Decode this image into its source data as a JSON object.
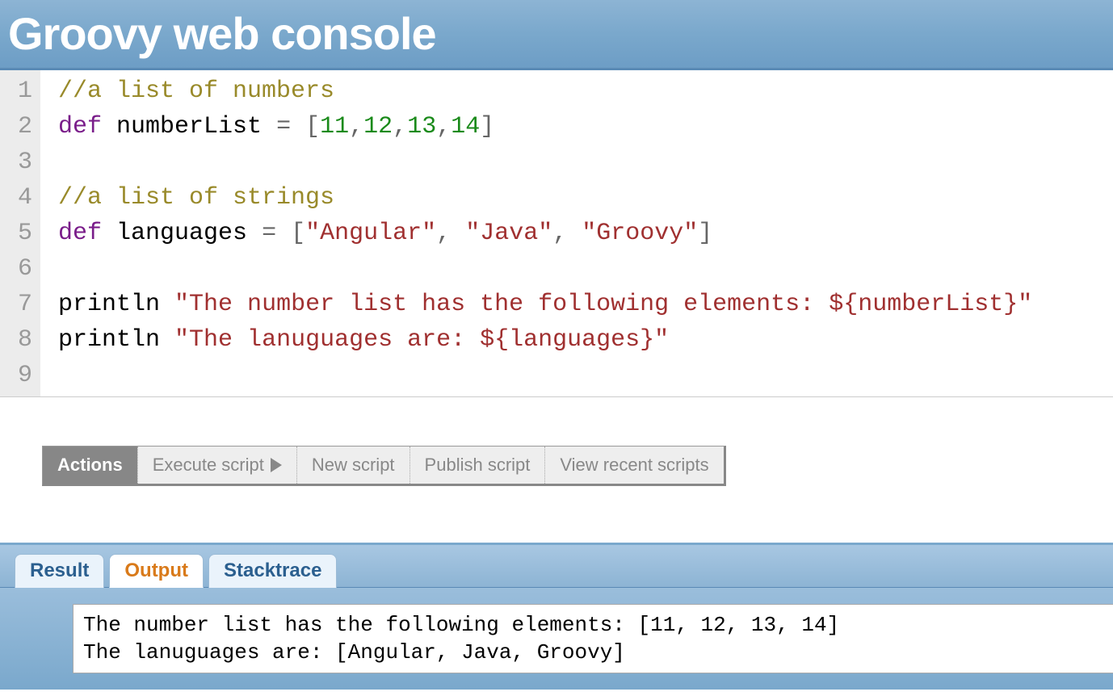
{
  "header": {
    "title": "Groovy web console"
  },
  "editor": {
    "line_numbers": [
      "1",
      "2",
      "3",
      "4",
      "5",
      "6",
      "7",
      "8",
      "9"
    ],
    "lines": [
      [
        {
          "t": "comment",
          "v": "//a list of numbers"
        }
      ],
      [
        {
          "t": "keyword",
          "v": "def"
        },
        {
          "t": "space",
          "v": " "
        },
        {
          "t": "ident",
          "v": "numberList"
        },
        {
          "t": "space",
          "v": " "
        },
        {
          "t": "punct",
          "v": "="
        },
        {
          "t": "space",
          "v": " "
        },
        {
          "t": "bracket",
          "v": "["
        },
        {
          "t": "number",
          "v": "11"
        },
        {
          "t": "punct",
          "v": ","
        },
        {
          "t": "number",
          "v": "12"
        },
        {
          "t": "punct",
          "v": ","
        },
        {
          "t": "number",
          "v": "13"
        },
        {
          "t": "punct",
          "v": ","
        },
        {
          "t": "number",
          "v": "14"
        },
        {
          "t": "bracket",
          "v": "]"
        }
      ],
      [],
      [
        {
          "t": "comment",
          "v": "//a list of strings"
        }
      ],
      [
        {
          "t": "keyword",
          "v": "def"
        },
        {
          "t": "space",
          "v": " "
        },
        {
          "t": "ident",
          "v": "languages"
        },
        {
          "t": "space",
          "v": " "
        },
        {
          "t": "punct",
          "v": "="
        },
        {
          "t": "space",
          "v": " "
        },
        {
          "t": "bracket",
          "v": "["
        },
        {
          "t": "string",
          "v": "\"Angular\""
        },
        {
          "t": "punct",
          "v": ","
        },
        {
          "t": "space",
          "v": " "
        },
        {
          "t": "string",
          "v": "\"Java\""
        },
        {
          "t": "punct",
          "v": ","
        },
        {
          "t": "space",
          "v": " "
        },
        {
          "t": "string",
          "v": "\"Groovy\""
        },
        {
          "t": "bracket",
          "v": "]"
        }
      ],
      [],
      [
        {
          "t": "ident",
          "v": "println"
        },
        {
          "t": "space",
          "v": " "
        },
        {
          "t": "string",
          "v": "\"The number list has the following elements: "
        },
        {
          "t": "interp",
          "v": "${numberList}"
        },
        {
          "t": "string",
          "v": "\""
        }
      ],
      [
        {
          "t": "ident",
          "v": "println"
        },
        {
          "t": "space",
          "v": " "
        },
        {
          "t": "string",
          "v": "\"The lanuguages are: "
        },
        {
          "t": "interp",
          "v": "${languages}"
        },
        {
          "t": "string",
          "v": "\""
        }
      ],
      []
    ]
  },
  "toolbar": {
    "label": "Actions",
    "buttons": {
      "execute": "Execute script",
      "new": "New script",
      "publish": "Publish script",
      "recent": "View recent scripts"
    }
  },
  "tabs": {
    "result": "Result",
    "output": "Output",
    "stacktrace": "Stacktrace",
    "active": "output"
  },
  "output": {
    "lines": [
      "The number list has the following elements: [11, 12, 13, 14]",
      "The lanuguages are: [Angular, Java, Groovy]"
    ]
  }
}
